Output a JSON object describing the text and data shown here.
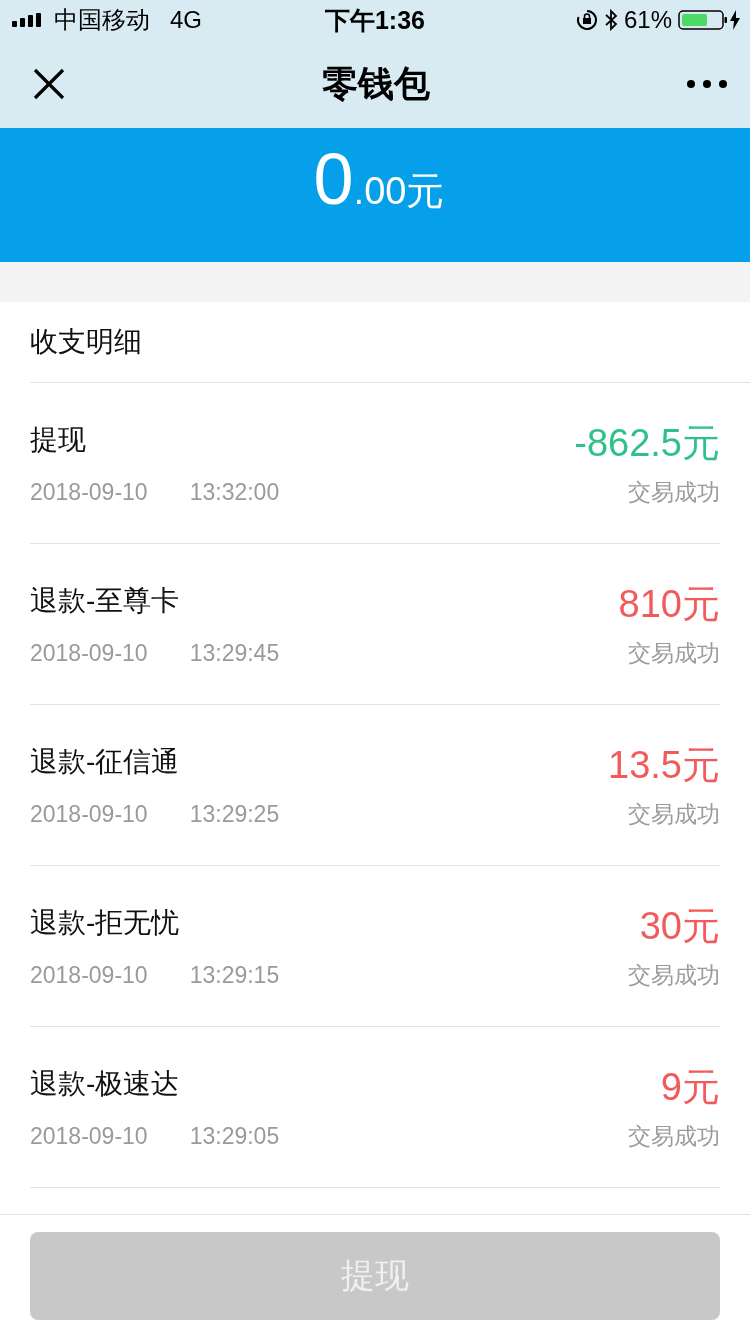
{
  "status_bar": {
    "carrier": "中国移动",
    "network": "4G",
    "time": "下午1:36",
    "battery": "61%"
  },
  "nav": {
    "title": "零钱包"
  },
  "balance": {
    "integer": "0",
    "decimal": ".00元"
  },
  "section": {
    "title": "收支明细"
  },
  "transactions": [
    {
      "title": "提现",
      "date": "2018-09-10",
      "time": "13:32:00",
      "amount": "-862.5元",
      "status": "交易成功",
      "color": "#2ec28a"
    },
    {
      "title": "退款-至尊卡",
      "date": "2018-09-10",
      "time": "13:29:45",
      "amount": "810元",
      "status": "交易成功",
      "color": "#f25b5b"
    },
    {
      "title": "退款-征信通",
      "date": "2018-09-10",
      "time": "13:29:25",
      "amount": "13.5元",
      "status": "交易成功",
      "color": "#f25b5b"
    },
    {
      "title": "退款-拒无忧",
      "date": "2018-09-10",
      "time": "13:29:15",
      "amount": "30元",
      "status": "交易成功",
      "color": "#f25b5b"
    },
    {
      "title": "退款-极速达",
      "date": "2018-09-10",
      "time": "13:29:05",
      "amount": "9元",
      "status": "交易成功",
      "color": "#f25b5b"
    }
  ],
  "withdraw_button": {
    "label": "提现",
    "disabled": true
  }
}
